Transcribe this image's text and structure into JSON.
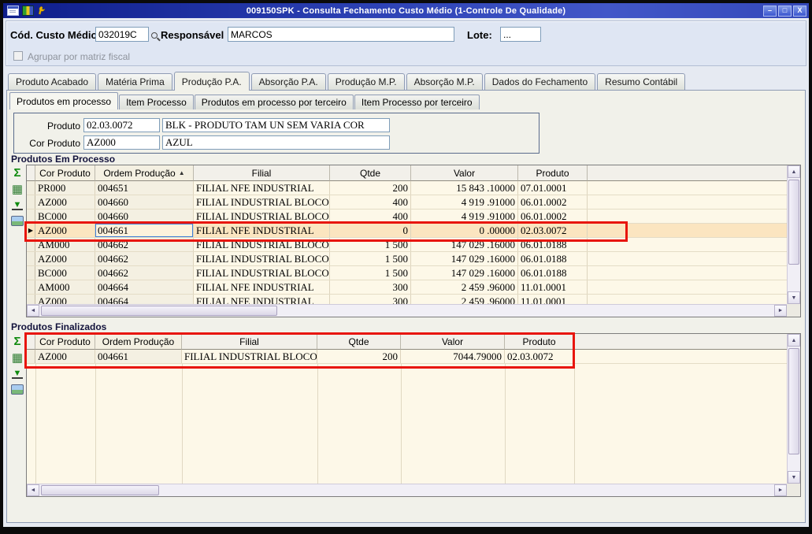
{
  "window": {
    "title": "009150SPK - Consulta Fechamento Custo Médio (1-Controle De Qualidade)",
    "minimize_glyph": "–",
    "maximize_glyph": "□",
    "close_glyph": "X"
  },
  "header": {
    "cod_label": "Cód. Custo Médio",
    "cod_value": "032019C",
    "resp_label": "Responsável",
    "resp_value": "MARCOS",
    "lote_label": "Lote:",
    "lote_value": "...",
    "agrupar_label": "Agrupar por matriz fiscal"
  },
  "tabs_main": {
    "items": [
      "Produto Acabado",
      "Matéria Prima",
      "Produção P.A.",
      "Absorção P.A.",
      "Produção M.P.",
      "Absorção M.P.",
      "Dados do Fechamento",
      "Resumo Contábil"
    ],
    "active": "Produção P.A."
  },
  "tabs_sub": {
    "items": [
      "Produtos em processo",
      "Item Processo",
      "Produtos em processo por terceiro",
      "Item Processo por terceiro"
    ],
    "active": "Produtos em processo"
  },
  "product_info": {
    "produto_label": "Produto",
    "produto_code": "02.03.0072",
    "produto_desc": "BLK - PRODUTO TAM UN SEM VARIA COR",
    "cor_label": "Cor Produto",
    "cor_code": "AZ000",
    "cor_desc": "AZUL"
  },
  "grid_processo": {
    "title": "Produtos Em Processo",
    "columns": [
      "Cor Produto",
      "Ordem Produção",
      "Filial",
      "Qtde",
      "Valor",
      "Produto"
    ],
    "sort_glyph": "▲",
    "rows": [
      {
        "cor": "PR000",
        "ordem": "004651",
        "filial": "FILIAL NFE INDUSTRIAL",
        "qtde": "200",
        "valor": "15 843 .10000",
        "produto": "07.01.0001"
      },
      {
        "cor": "AZ000",
        "ordem": "004660",
        "filial": "FILIAL INDUSTRIAL BLOCO K",
        "qtde": "400",
        "valor": "4 919 .91000",
        "produto": "06.01.0002"
      },
      {
        "cor": "BC000",
        "ordem": "004660",
        "filial": "FILIAL INDUSTRIAL BLOCO K",
        "qtde": "400",
        "valor": "4 919 .91000",
        "produto": "06.01.0002"
      },
      {
        "cor": "AZ000",
        "ordem": "004661",
        "filial": "FILIAL NFE INDUSTRIAL",
        "qtde": "0",
        "valor": "0 .00000",
        "produto": "02.03.0072",
        "selected": true
      },
      {
        "cor": "AM000",
        "ordem": "004662",
        "filial": "FILIAL INDUSTRIAL BLOCO K",
        "qtde": "1 500",
        "valor": "147 029 .16000",
        "produto": "06.01.0188"
      },
      {
        "cor": "AZ000",
        "ordem": "004662",
        "filial": "FILIAL INDUSTRIAL BLOCO K",
        "qtde": "1 500",
        "valor": "147 029 .16000",
        "produto": "06.01.0188"
      },
      {
        "cor": "BC000",
        "ordem": "004662",
        "filial": "FILIAL INDUSTRIAL BLOCO K",
        "qtde": "1 500",
        "valor": "147 029 .16000",
        "produto": "06.01.0188"
      },
      {
        "cor": "AM000",
        "ordem": "004664",
        "filial": "FILIAL NFE INDUSTRIAL",
        "qtde": "300",
        "valor": "2 459 .96000",
        "produto": "11.01.0001"
      },
      {
        "cor": "AZ000",
        "ordem": "004664",
        "filial": "FILIAL NFE INDUSTRIAL",
        "qtde": "300",
        "valor": "2 459 .96000",
        "produto": "11.01.0001"
      }
    ]
  },
  "grid_finalizados": {
    "title": "Produtos Finalizados",
    "columns": [
      "Cor Produto",
      "Ordem Produção",
      "Filial",
      "Qtde",
      "Valor",
      "Produto"
    ],
    "rows": [
      {
        "cor": "AZ000",
        "ordem": "004661",
        "filial": "FILIAL INDUSTRIAL BLOCO K",
        "qtde": "200",
        "valor": "7044.79000",
        "produto": "02.03.0072"
      }
    ]
  },
  "icons": {
    "sum_glyph": "Σ",
    "export_glyph": "▦",
    "download_glyph": "▼",
    "scroll_up": "▲",
    "scroll_down": "▼",
    "scroll_left": "◄",
    "scroll_right": "►",
    "row_pointer": "▶"
  },
  "colors": {
    "titlebar": "#2c41b4",
    "grid_row_bg": "#fdf8e8",
    "grid_selected_bg": "#fbe5c0",
    "annotation": "#e8150d"
  }
}
